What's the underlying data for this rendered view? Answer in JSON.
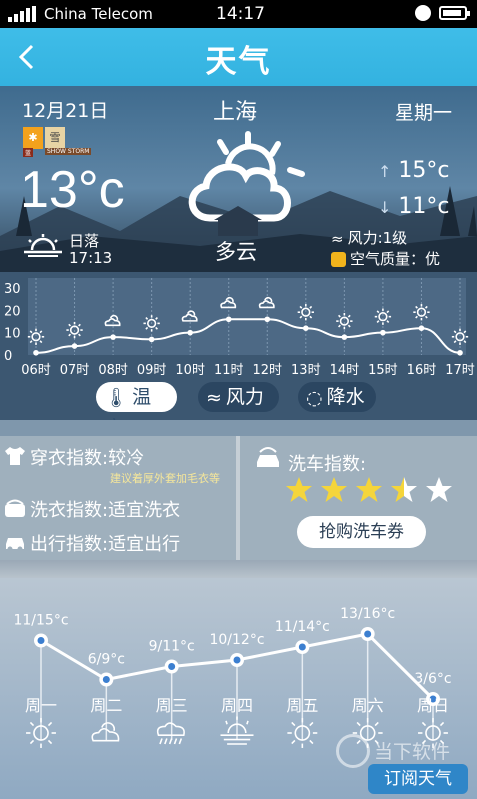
{
  "status_bar": {
    "carrier": "China Telecom",
    "time": "14:17"
  },
  "header": {
    "title": "天气"
  },
  "current": {
    "date": "12月21日",
    "city": "上海",
    "weekday": "星期一",
    "alert_badges": [
      {
        "icon": "snow",
        "caption": "蓝"
      },
      {
        "icon": "storm",
        "caption": "SHOW STORM"
      }
    ],
    "temperature": "13°c",
    "condition": "多云",
    "high": "15°c",
    "low": "11°c",
    "sunset_label": "日落",
    "sunset_time": "17:13",
    "wind": "风力:1级",
    "air_quality": "空气质量：优"
  },
  "chart_data": {
    "type": "line",
    "x": [
      "06时",
      "07时",
      "08时",
      "09时",
      "10时",
      "11时",
      "12时",
      "13时",
      "14时",
      "15时",
      "16时",
      "17时"
    ],
    "series": [
      {
        "values": [
          1,
          4,
          8,
          7,
          10,
          16,
          16,
          12,
          8,
          10,
          12,
          1
        ]
      }
    ],
    "yticks": [
      0,
      10,
      20,
      30
    ],
    "ylim": [
      0,
      30
    ],
    "icons": [
      "sun",
      "sun",
      "cloudy",
      "sun",
      "cloudy",
      "cloudy",
      "cloudy",
      "sun",
      "sun",
      "sun",
      "sun",
      "sun"
    ],
    "grid": true
  },
  "tabs": [
    {
      "label": "温度"
    },
    {
      "label": "风力"
    },
    {
      "label": "降水"
    }
  ],
  "indices": {
    "clothing": "穿衣指数:较冷",
    "clothing_note": "建议着厚外套加毛衣等",
    "laundry": "洗衣指数:适宜洗衣",
    "travel": "出行指数:适宜出行",
    "carwash_title": "洗车指数:",
    "carwash_rating": 3.5,
    "carwash_rating_max": 5,
    "carwash_button": "抢购洗车券"
  },
  "weekly": [
    {
      "day": "周一",
      "range": "11/15°c",
      "high": 15,
      "icon": "sun"
    },
    {
      "day": "周二",
      "range": "6/9°c",
      "high": 9,
      "icon": "cloudy"
    },
    {
      "day": "周三",
      "range": "9/11°c",
      "high": 11,
      "icon": "rain"
    },
    {
      "day": "周四",
      "range": "10/12°c",
      "high": 12,
      "icon": "sunrise"
    },
    {
      "day": "周五",
      "range": "11/14°c",
      "high": 14,
      "icon": "sun"
    },
    {
      "day": "周六",
      "range": "13/16°c",
      "high": 16,
      "icon": "sun"
    },
    {
      "day": "周日",
      "range": "3/6°c",
      "high": 6,
      "icon": "sun"
    }
  ],
  "watermark": "当下软件园",
  "subscribe_button": "订阅天气",
  "colors": {
    "title_bar": "#38b8e4",
    "star": "#f5d53a",
    "button_blue": "#2f86c8"
  }
}
